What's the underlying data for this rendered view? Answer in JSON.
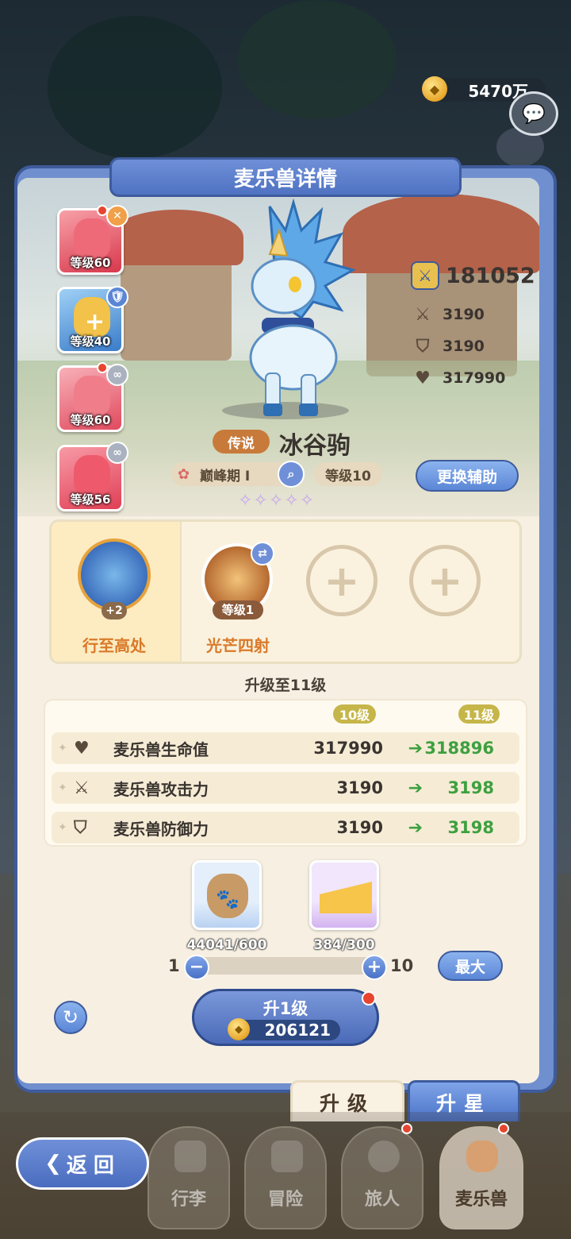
{
  "currency": {
    "gold": "5470万",
    "icon": "coin-icon"
  },
  "panel": {
    "title": "麦乐兽详情"
  },
  "helpers": [
    {
      "level": "等级60",
      "color": "#e85a6a",
      "badge": "✕"
    },
    {
      "level": "等级40",
      "color": "#5aa0e0",
      "badge": "🛡"
    },
    {
      "level": "等级60",
      "color": "#ef6d7e",
      "badge": "∞"
    },
    {
      "level": "等级56",
      "color": "#ef5568",
      "badge": "∞"
    }
  ],
  "monster": {
    "rarity": "传说",
    "name": "冰谷驹",
    "stage": "巅峰期 I",
    "level": "等级10",
    "power": "181052",
    "attack": "3190",
    "defense": "3190",
    "hp": "317990",
    "stars": "✧✧✧✧✧"
  },
  "swap_button": "更换辅助",
  "skills": [
    {
      "name": "行至高处",
      "badge": "+2"
    },
    {
      "name": "光芒四射",
      "level": "等级1"
    }
  ],
  "upgrade": {
    "title": "升级至11级",
    "from_level": "10级",
    "to_level": "11级",
    "rows": [
      {
        "label": "麦乐兽生命值",
        "from": "317990",
        "to": "318896",
        "icon": "heart-icon"
      },
      {
        "label": "麦乐兽攻击力",
        "from": "3190",
        "to": "3198",
        "icon": "swords-icon"
      },
      {
        "label": "麦乐兽防御力",
        "from": "3190",
        "to": "3198",
        "icon": "shield-icon"
      }
    ]
  },
  "materials": [
    {
      "count": "44041/600",
      "icon": "paw-bag-icon"
    },
    {
      "count": "384/300",
      "icon": "cheese-icon"
    }
  ],
  "slider": {
    "min": "1",
    "max": "10",
    "value": 0,
    "max_button": "最大"
  },
  "level_up": {
    "label": "升1级",
    "cost": "206121"
  },
  "tabs": {
    "upgrade": "升级",
    "star": "升星"
  },
  "nav": {
    "back": "返回",
    "items": [
      "行李",
      "冒险",
      "旅人",
      "麦乐兽"
    ]
  }
}
